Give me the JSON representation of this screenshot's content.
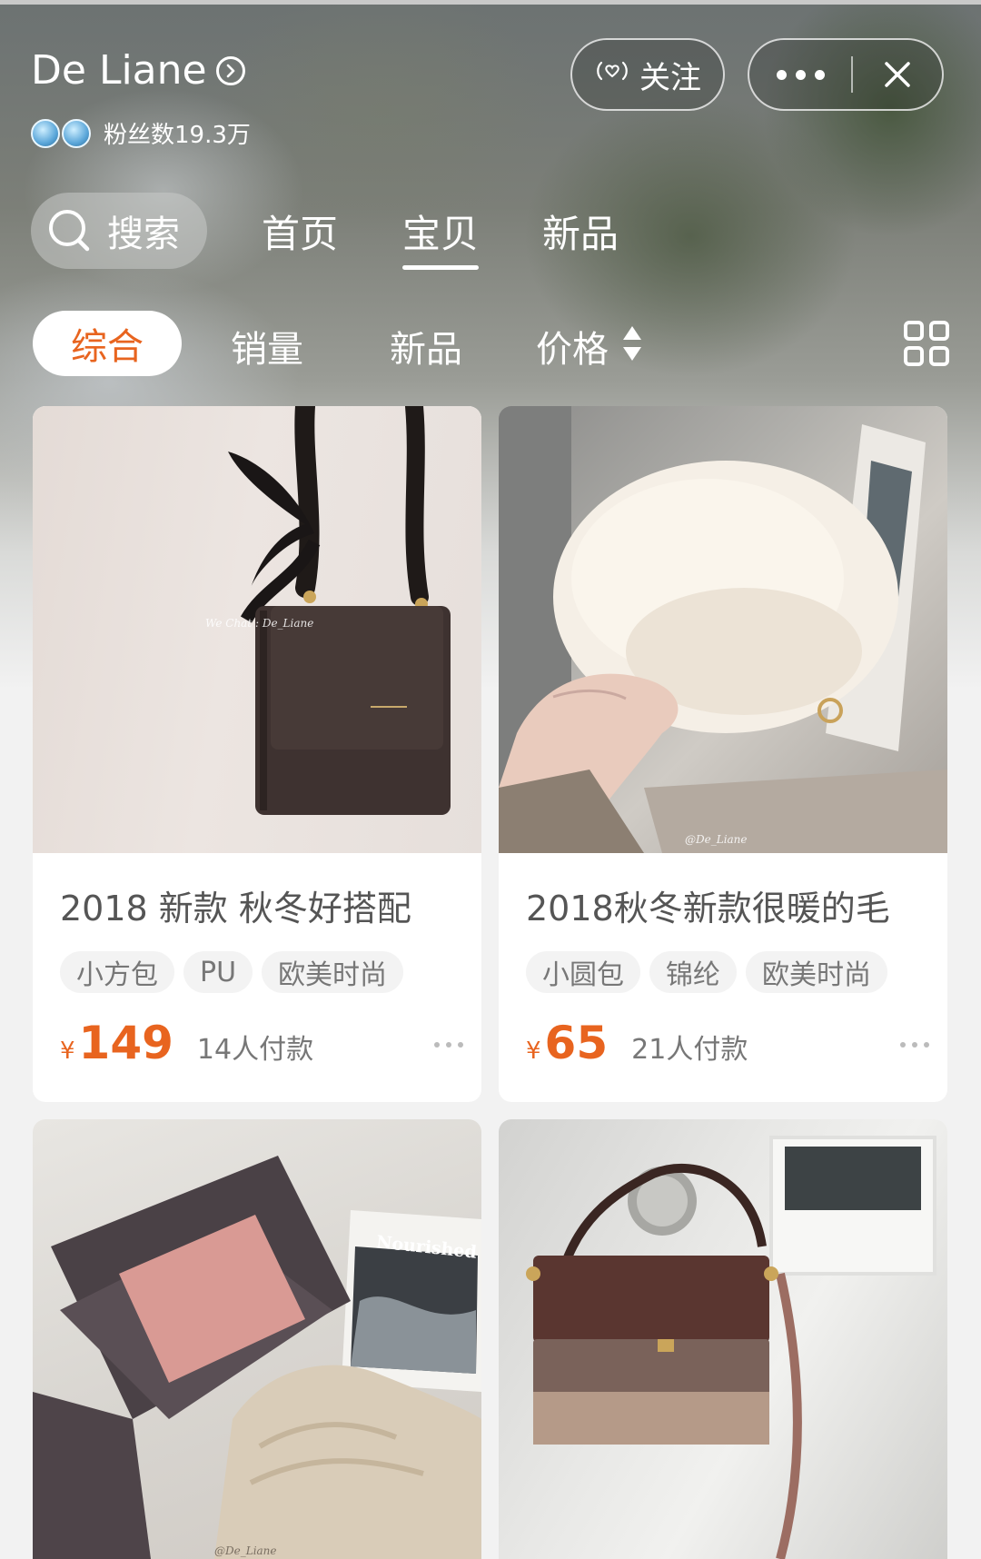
{
  "header": {
    "store_name": "De Liane",
    "fans_label": "粉丝数19.3万",
    "follow_label": "关注"
  },
  "nav": {
    "search_label": "搜索",
    "tabs": [
      {
        "label": "首页",
        "active": false
      },
      {
        "label": "宝贝",
        "active": true
      },
      {
        "label": "新品",
        "active": false
      }
    ]
  },
  "sort": {
    "items": [
      {
        "label": "综合",
        "active": true
      },
      {
        "label": "销量",
        "active": false
      },
      {
        "label": "新品",
        "active": false
      },
      {
        "label": "价格",
        "active": false
      }
    ]
  },
  "products": [
    {
      "title": "2018 新款 秋冬好搭配",
      "tags": [
        "小方包",
        "PU",
        "欧美时尚"
      ],
      "currency": "¥",
      "price": "149",
      "sold": "14人付款",
      "watermark": "We Chat : De_Liane"
    },
    {
      "title": "2018秋冬新款很暖的毛",
      "tags": [
        "小圆包",
        "锦纶",
        "欧美时尚"
      ],
      "currency": "¥",
      "price": "65",
      "sold": "21人付款",
      "watermark": "@De_Liane"
    },
    {
      "title": "",
      "tags": [],
      "watermark": "@De_Liane",
      "book_text": "Nourished"
    },
    {
      "title": "",
      "tags": []
    }
  ],
  "colors": {
    "accent": "#e8641f",
    "tag_bg": "#f3f3f3"
  }
}
